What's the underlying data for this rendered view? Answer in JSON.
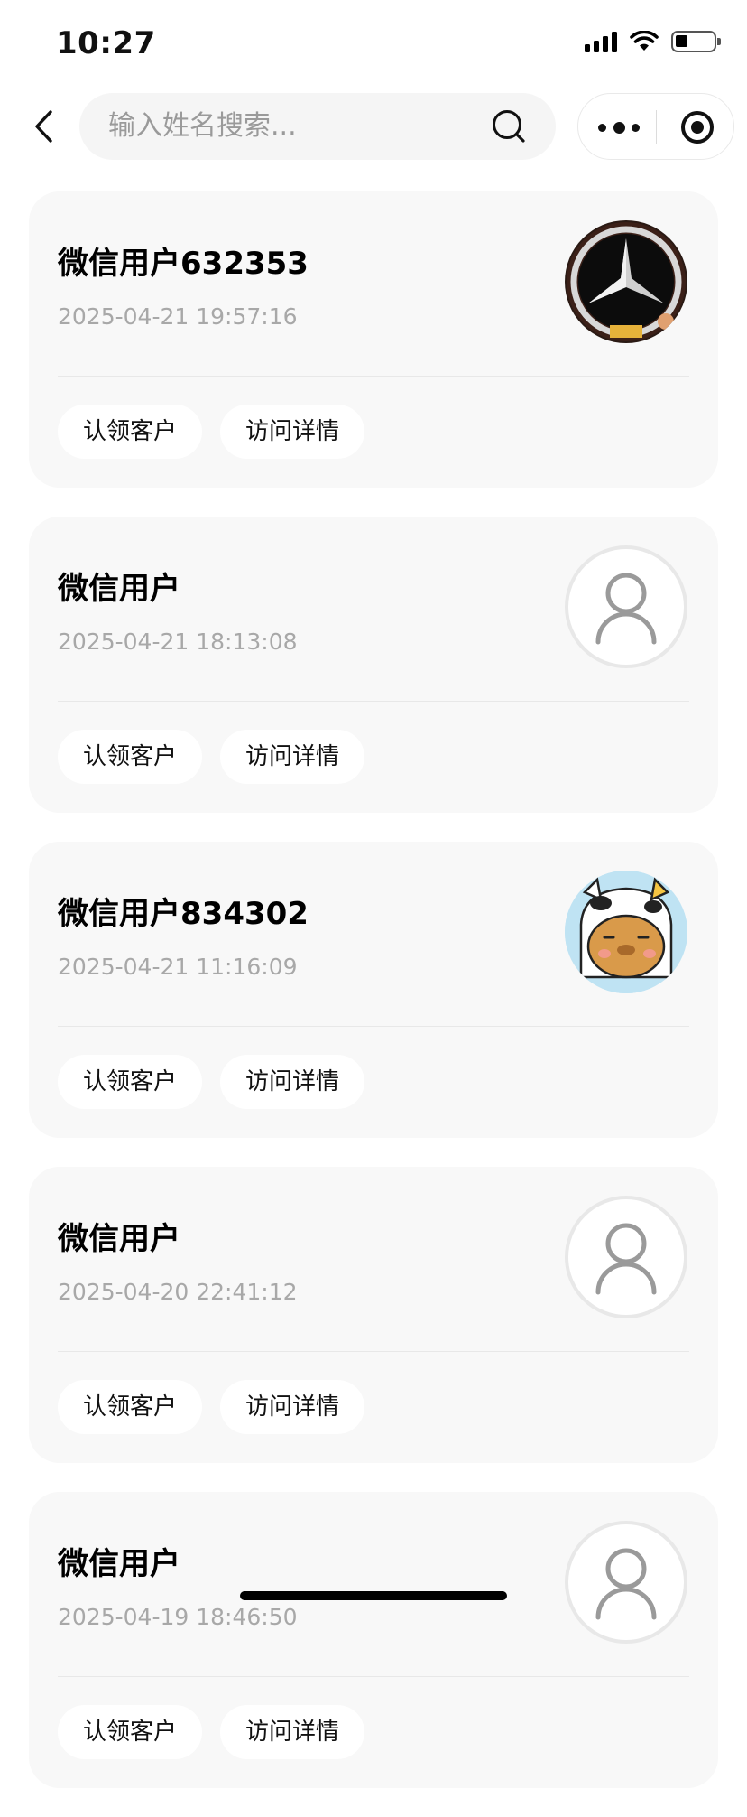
{
  "status_bar": {
    "time": "10:27"
  },
  "search": {
    "placeholder": "输入姓名搜索..."
  },
  "cards": [
    {
      "name": "微信用户632353",
      "time": "2025-04-21 19:57:16",
      "avatar": "mercedes-logo-avatar",
      "claim": "认领客户",
      "visit": "访问详情"
    },
    {
      "name": "微信用户",
      "time": "2025-04-21 18:13:08",
      "avatar": "default-user-icon",
      "claim": "认领客户",
      "visit": "访问详情"
    },
    {
      "name": "微信用户834302",
      "time": "2025-04-21 11:16:09",
      "avatar": "capybara-cartoon-avatar",
      "claim": "认领客户",
      "visit": "访问详情"
    },
    {
      "name": "微信用户",
      "time": "2025-04-20 22:41:12",
      "avatar": "default-user-icon",
      "claim": "认领客户",
      "visit": "访问详情"
    },
    {
      "name": "微信用户",
      "time": "2025-04-19 18:46:50",
      "avatar": "default-user-icon",
      "claim": "认领客户",
      "visit": "访问详情"
    }
  ],
  "colors": {
    "card_background": "#f8f8f8",
    "timestamp_text": "#a8a8a8",
    "search_background": "#f5f5f5"
  }
}
